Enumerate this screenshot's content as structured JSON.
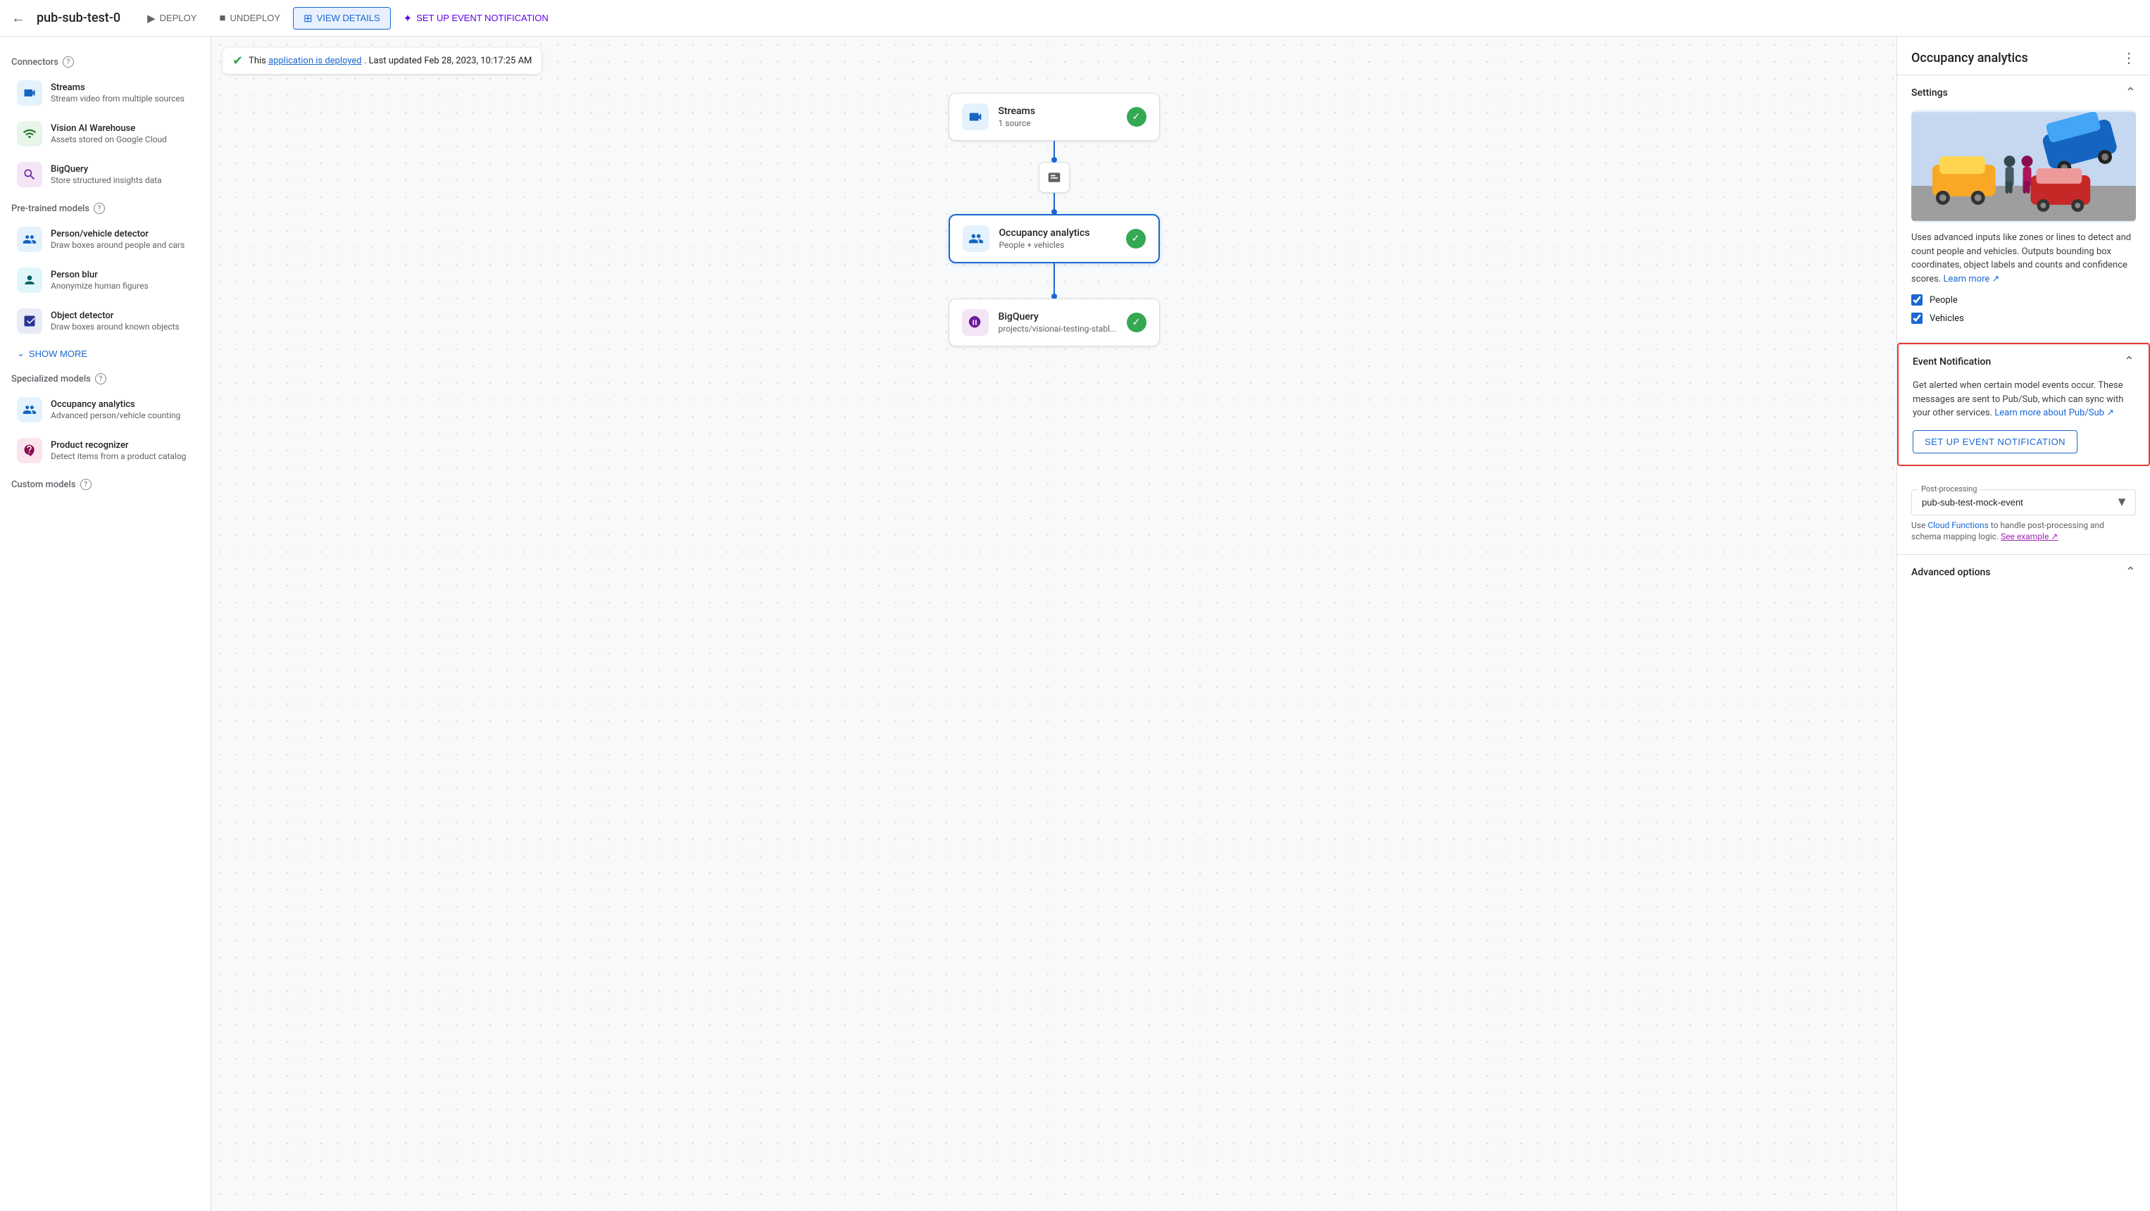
{
  "topbar": {
    "back_icon": "←",
    "title": "pub-sub-test-0",
    "buttons": [
      {
        "id": "deploy",
        "label": "DEPLOY",
        "icon": "▶",
        "style": "default"
      },
      {
        "id": "undeploy",
        "label": "UNDEPLOY",
        "icon": "■",
        "style": "default"
      },
      {
        "id": "view-details",
        "label": "VIEW DETAILS",
        "icon": "⊞",
        "style": "primary"
      },
      {
        "id": "setup-event",
        "label": "SET UP EVENT NOTIFICATION",
        "icon": "✦",
        "style": "setup"
      }
    ]
  },
  "status_bar": {
    "text": "This",
    "link_text": "application is deployed",
    "suffix": ". Last updated Feb 28, 2023, 10:17:25 AM"
  },
  "sidebar": {
    "connectors_title": "Connectors",
    "connectors": [
      {
        "id": "streams",
        "name": "Streams",
        "desc": "Stream video from multiple sources",
        "icon": "📹",
        "icon_class": "icon-streams"
      },
      {
        "id": "vision-ai",
        "name": "Vision AI Warehouse",
        "desc": "Assets stored on Google Cloud",
        "icon": "🏛",
        "icon_class": "icon-vision"
      },
      {
        "id": "bigquery",
        "name": "BigQuery",
        "desc": "Store structured insights data",
        "icon": "◎",
        "icon_class": "icon-bigquery"
      }
    ],
    "pretrained_title": "Pre-trained models",
    "pretrained": [
      {
        "id": "person-vehicle",
        "name": "Person/vehicle detector",
        "desc": "Draw boxes around people and cars",
        "icon": "👤",
        "icon_class": "icon-person-vehicle"
      },
      {
        "id": "person-blur",
        "name": "Person blur",
        "desc": "Anonymize human figures",
        "icon": "👁",
        "icon_class": "icon-person-blur"
      },
      {
        "id": "object-detector",
        "name": "Object detector",
        "desc": "Draw boxes around known objects",
        "icon": "⬡",
        "icon_class": "icon-object-detector"
      }
    ],
    "show_more_label": "SHOW MORE",
    "specialized_title": "Specialized models",
    "specialized": [
      {
        "id": "occupancy",
        "name": "Occupancy analytics",
        "desc": "Advanced person/vehicle counting",
        "icon": "👥",
        "icon_class": "icon-occupancy"
      },
      {
        "id": "product",
        "name": "Product recognizer",
        "desc": "Detect items from a product catalog",
        "icon": "👕",
        "icon_class": "icon-product"
      }
    ],
    "custom_title": "Custom models"
  },
  "pipeline": {
    "nodes": [
      {
        "id": "streams-node",
        "name": "Streams",
        "sub": "1 source",
        "icon": "📹",
        "icon_class": "icon-streams",
        "checked": true
      },
      {
        "id": "occupancy-node",
        "name": "Occupancy analytics",
        "sub": "People + vehicles",
        "icon": "👥",
        "icon_class": "icon-occupancy",
        "checked": true,
        "selected": true
      },
      {
        "id": "bigquery-node",
        "name": "BigQuery",
        "sub": "projects/visionai-testing-stabl...",
        "icon": "◎",
        "icon_class": "icon-bigquery",
        "checked": true
      }
    ]
  },
  "right_panel": {
    "title": "Occupancy analytics",
    "more_icon": "⋮",
    "settings": {
      "title": "Settings",
      "description": "Uses advanced inputs like zones or lines to detect and count people and vehicles. Outputs bounding box coordinates, object labels and counts and confidence scores.",
      "learn_more_text": "Learn more",
      "checkboxes": [
        {
          "id": "people",
          "label": "People",
          "checked": true
        },
        {
          "id": "vehicles",
          "label": "Vehicles",
          "checked": true
        }
      ]
    },
    "event_notification": {
      "title": "Event Notification",
      "description": "Get alerted when certain model events occur. These messages are sent to Pub/Sub, which can sync with your other services.",
      "learn_more_text": "Learn more about Pub/Sub",
      "setup_button": "SET UP EVENT NOTIFICATION",
      "highlighted": true
    },
    "post_processing": {
      "label": "Post-processing",
      "value": "pub-sub-test-mock-event",
      "options": [
        "pub-sub-test-mock-event"
      ],
      "description": "Use Cloud Functions to handle post-processing and schema mapping logic.",
      "see_example_text": "See example"
    },
    "advanced_options": {
      "title": "Advanced options"
    }
  }
}
